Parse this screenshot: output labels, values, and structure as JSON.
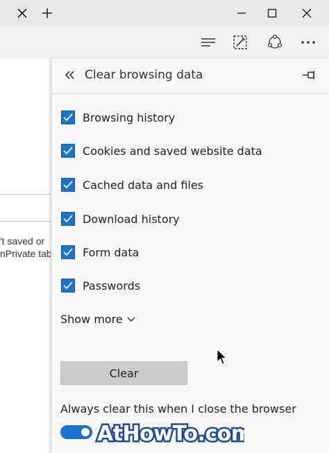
{
  "window": {
    "tab_close_icon": "close-icon",
    "new_tab_icon": "plus-icon",
    "controls": [
      "minimize-icon",
      "maximize-icon",
      "close-icon"
    ]
  },
  "toolbar": {
    "icons": [
      "hub-icon",
      "web-note-icon",
      "share-icon",
      "more-icon"
    ]
  },
  "background_page": {
    "line1": "'t saved or",
    "line2": "nPrivate tab"
  },
  "pane": {
    "title": "Clear browsing data",
    "back_icon": "double-chevron-left-icon",
    "pin_icon": "pin-icon",
    "options": [
      {
        "label": "Browsing history",
        "checked": true
      },
      {
        "label": "Cookies and saved website data",
        "checked": true
      },
      {
        "label": "Cached data and files",
        "checked": true
      },
      {
        "label": "Download history",
        "checked": true
      },
      {
        "label": "Form data",
        "checked": true
      },
      {
        "label": "Passwords",
        "checked": true
      }
    ],
    "show_more": "Show more",
    "clear_button": "Clear",
    "always_clear_label": "Always clear this when I close the browser",
    "always_clear_on": true
  },
  "watermark": "AtHowTo.com",
  "colors": {
    "accent": "#1a73d1",
    "tab_bar": "#e8e8e8",
    "toolbar": "#f2f2f2",
    "pane_bg": "#f7f7f7",
    "button_bg": "#cccccc"
  }
}
